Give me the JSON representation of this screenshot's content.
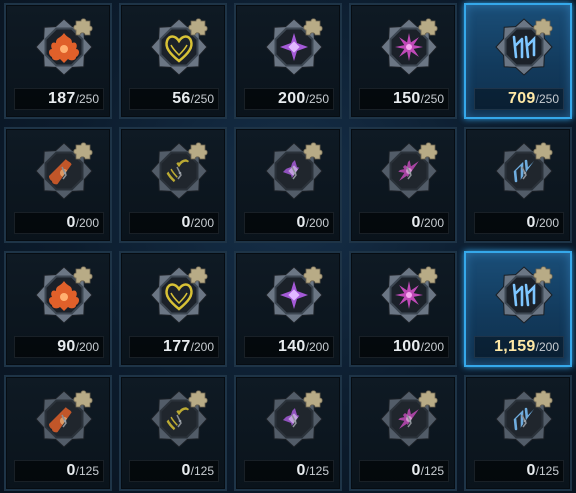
{
  "rows": [
    [
      {
        "type": "fire",
        "color": "#e0602a",
        "state": "full",
        "current": "187",
        "max": "/250"
      },
      {
        "type": "heart",
        "color": "#d8c236",
        "state": "full",
        "current": "56",
        "max": "/250"
      },
      {
        "type": "cross",
        "color": "#a55ad8",
        "state": "full",
        "current": "200",
        "max": "/250"
      },
      {
        "type": "star",
        "color": "#c04ab8",
        "state": "full",
        "current": "150",
        "max": "/250"
      },
      {
        "type": "rune",
        "color": "#7ec6ff",
        "state": "full",
        "current": "709",
        "max": "/250",
        "selected": true
      }
    ],
    [
      {
        "type": "fire",
        "color": "#e0602a",
        "state": "fragment",
        "current": "0",
        "max": "/200"
      },
      {
        "type": "heart",
        "color": "#d8c236",
        "state": "fragment",
        "current": "0",
        "max": "/200"
      },
      {
        "type": "cross",
        "color": "#a55ad8",
        "state": "fragment",
        "current": "0",
        "max": "/200"
      },
      {
        "type": "star",
        "color": "#c04ab8",
        "state": "fragment",
        "current": "0",
        "max": "/200"
      },
      {
        "type": "rune",
        "color": "#7ec6ff",
        "state": "fragment",
        "current": "0",
        "max": "/200"
      }
    ],
    [
      {
        "type": "fire",
        "color": "#e0602a",
        "state": "full",
        "current": "90",
        "max": "/200"
      },
      {
        "type": "heart",
        "color": "#d8c236",
        "state": "full",
        "current": "177",
        "max": "/200"
      },
      {
        "type": "cross",
        "color": "#a55ad8",
        "state": "full",
        "current": "140",
        "max": "/200"
      },
      {
        "type": "star",
        "color": "#c04ab8",
        "state": "full",
        "current": "100",
        "max": "/200"
      },
      {
        "type": "rune",
        "color": "#7ec6ff",
        "state": "full",
        "current": "1,159",
        "max": "/200",
        "selected": true
      }
    ],
    [
      {
        "type": "fire",
        "color": "#e0602a",
        "state": "fragment",
        "current": "0",
        "max": "/125"
      },
      {
        "type": "heart",
        "color": "#d8c236",
        "state": "fragment",
        "current": "0",
        "max": "/125"
      },
      {
        "type": "cross",
        "color": "#a55ad8",
        "state": "fragment",
        "current": "0",
        "max": "/125"
      },
      {
        "type": "star",
        "color": "#c04ab8",
        "state": "fragment",
        "current": "0",
        "max": "/125"
      },
      {
        "type": "rune",
        "color": "#7ec6ff",
        "state": "fragment",
        "current": "0",
        "max": "/125"
      }
    ]
  ],
  "colors": {
    "cell_border": "#1e3447",
    "selected_border": "#35a8ea",
    "puzzle": "#b8ab86"
  },
  "icon_names": {
    "fire": "fire-rune-icon",
    "heart": "heart-rune-icon",
    "cross": "cross-rune-icon",
    "star": "star-rune-icon",
    "rune": "ice-rune-icon",
    "puzzle": "puzzle-piece-icon"
  }
}
